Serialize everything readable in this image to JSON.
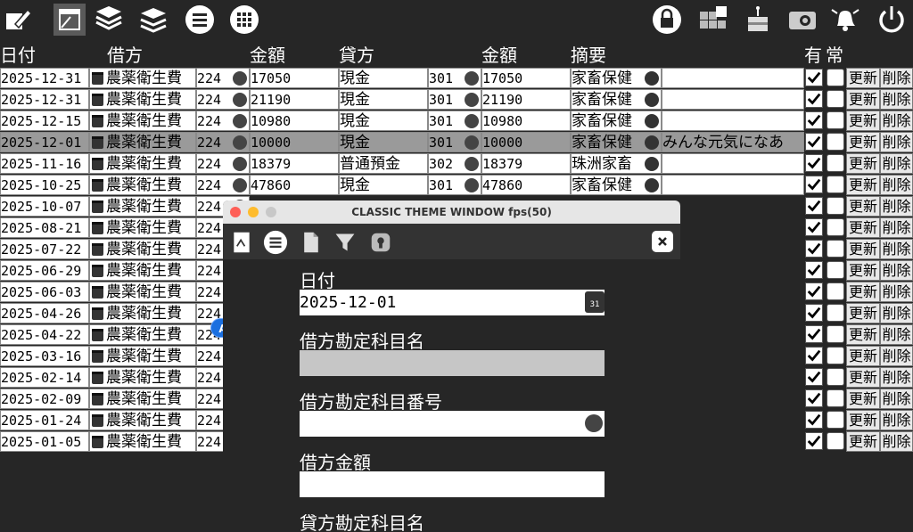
{
  "columns": {
    "date": "日付",
    "debit": "借方",
    "amount1": "金額",
    "credit": "貸方",
    "amount2": "金額",
    "memo": "摘要",
    "flag_yes": "有",
    "flag_normal": "常"
  },
  "row_buttons": {
    "update": "更新",
    "delete": "削除"
  },
  "rows": [
    {
      "date": "2025-12-31",
      "debit": "農薬衛生費",
      "debit_no": "224",
      "amount": "17050",
      "credit": "現金",
      "credit_no": "301",
      "amount2": "17050",
      "memo": "家畜保健",
      "note": ""
    },
    {
      "date": "2025-12-31",
      "debit": "農薬衛生費",
      "debit_no": "224",
      "amount": "21190",
      "credit": "現金",
      "credit_no": "301",
      "amount2": "21190",
      "memo": "家畜保健",
      "note": ""
    },
    {
      "date": "2025-12-15",
      "debit": "農薬衛生費",
      "debit_no": "224",
      "amount": "10980",
      "credit": "現金",
      "credit_no": "301",
      "amount2": "10980",
      "memo": "家畜保健",
      "note": ""
    },
    {
      "date": "2025-12-01",
      "debit": "農薬衛生費",
      "debit_no": "224",
      "amount": "10000",
      "credit": "現金",
      "credit_no": "301",
      "amount2": "10000",
      "memo": "家畜保健",
      "note": "みんな元気になあ"
    },
    {
      "date": "2025-11-16",
      "debit": "農薬衛生費",
      "debit_no": "224",
      "amount": "18379",
      "credit": "普通預金",
      "credit_no": "302",
      "amount2": "18379",
      "memo": "珠洲家畜",
      "note": ""
    },
    {
      "date": "2025-10-25",
      "debit": "農薬衛生費",
      "debit_no": "224",
      "amount": "47860",
      "credit": "現金",
      "credit_no": "301",
      "amount2": "47860",
      "memo": "家畜保健",
      "note": ""
    },
    {
      "date": "2025-10-07",
      "debit": "農薬衛生費",
      "debit_no": "224"
    },
    {
      "date": "2025-08-21",
      "debit": "農薬衛生費",
      "debit_no": "224"
    },
    {
      "date": "2025-07-22",
      "debit": "農薬衛生費",
      "debit_no": "224"
    },
    {
      "date": "2025-06-29",
      "debit": "農薬衛生費",
      "debit_no": "224"
    },
    {
      "date": "2025-06-03",
      "debit": "農薬衛生費",
      "debit_no": "224"
    },
    {
      "date": "2025-04-26",
      "debit": "農薬衛生費",
      "debit_no": "224"
    },
    {
      "date": "2025-04-22",
      "debit": "農薬衛生費",
      "debit_no": "224"
    },
    {
      "date": "2025-03-16",
      "debit": "農薬衛生費",
      "debit_no": "224"
    },
    {
      "date": "2025-02-14",
      "debit": "農薬衛生費",
      "debit_no": "224"
    },
    {
      "date": "2025-02-09",
      "debit": "農薬衛生費",
      "debit_no": "224"
    },
    {
      "date": "2025-01-24",
      "debit": "農薬衛生費",
      "debit_no": "224"
    },
    {
      "date": "2025-01-05",
      "debit": "農薬衛生費",
      "debit_no": "224"
    }
  ],
  "selected_row": 3,
  "modal": {
    "title": "CLASSIC THEME WINDOW fps(50)",
    "fields": [
      {
        "label": "日付",
        "value": "2025-12-01"
      },
      {
        "label": "借方勘定科目名",
        "value": ""
      },
      {
        "label": "借方勘定科目番号",
        "value": ""
      },
      {
        "label": "借方金額",
        "value": ""
      },
      {
        "label": "貸方勘定科目名",
        "value": ""
      }
    ],
    "calendar_day": "31"
  },
  "badge": "A",
  "icons": [
    "edit-icon",
    "window-icon",
    "stack-icon",
    "stack-icon",
    "menu-icon",
    "grid-icon",
    "lock-icon",
    "puzzle-icon",
    "cake-icon",
    "camera-icon",
    "bell-icon",
    "power-icon"
  ],
  "colors": {
    "background": "#262626",
    "selected_row": "#9a9a9a",
    "badge": "#1a6fe0"
  }
}
